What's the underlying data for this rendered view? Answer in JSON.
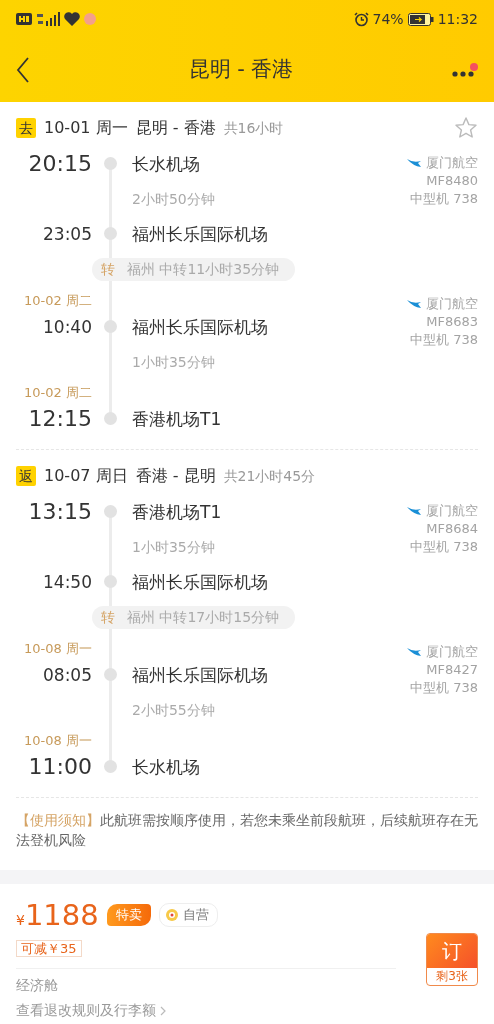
{
  "status_bar": {
    "battery": "74%",
    "time": "11:32"
  },
  "header": {
    "title": "昆明 - 香港",
    "has_notification": true
  },
  "trips": [
    {
      "tag": "去",
      "date": "10-01 周一",
      "route": "昆明 - 香港",
      "total": "共16小时",
      "starred": false,
      "timeline": [
        {
          "kind": "stop",
          "endpoint": true,
          "time": "20:15",
          "airport": "长水机场",
          "airline": {
            "name": "厦门航空",
            "flight": "MF8480",
            "aircraft": "中型机 738"
          }
        },
        {
          "kind": "duration",
          "text": "2小时50分钟"
        },
        {
          "kind": "stop",
          "endpoint": false,
          "time": "23:05",
          "airport": "福州长乐国际机场"
        },
        {
          "kind": "transfer",
          "tag": "转",
          "text": "福州 中转11小时35分钟"
        },
        {
          "kind": "stop",
          "endpoint": false,
          "date": "10-02 周二",
          "time": "10:40",
          "airport": "福州长乐国际机场",
          "airline": {
            "name": "厦门航空",
            "flight": "MF8683",
            "aircraft": "中型机 738"
          }
        },
        {
          "kind": "duration",
          "text": "1小时35分钟"
        },
        {
          "kind": "stop",
          "endpoint": true,
          "date": "10-02 周二",
          "time": "12:15",
          "airport": "香港机场T1"
        }
      ]
    },
    {
      "tag": "返",
      "date": "10-07 周日",
      "route": "香港 - 昆明",
      "total": "共21小时45分",
      "timeline": [
        {
          "kind": "stop",
          "endpoint": true,
          "time": "13:15",
          "airport": "香港机场T1",
          "airline": {
            "name": "厦门航空",
            "flight": "MF8684",
            "aircraft": "中型机 738"
          }
        },
        {
          "kind": "duration",
          "text": "1小时35分钟"
        },
        {
          "kind": "stop",
          "endpoint": false,
          "time": "14:50",
          "airport": "福州长乐国际机场"
        },
        {
          "kind": "transfer",
          "tag": "转",
          "text": "福州 中转17小时15分钟"
        },
        {
          "kind": "stop",
          "endpoint": false,
          "date": "10-08 周一",
          "time": "08:05",
          "airport": "福州长乐国际机场",
          "airline": {
            "name": "厦门航空",
            "flight": "MF8427",
            "aircraft": "中型机 738"
          }
        },
        {
          "kind": "duration",
          "text": "2小时55分钟"
        },
        {
          "kind": "stop",
          "endpoint": true,
          "date": "10-08 周一",
          "time": "11:00",
          "airport": "长水机场"
        }
      ]
    }
  ],
  "notice": {
    "label": "【使用须知】",
    "text": "此航班需按顺序使用，若您未乘坐前段航班，后续航班存在无法登机风险"
  },
  "fare": {
    "currency": "¥",
    "price": "1188",
    "promo_tag": "特卖",
    "self_operated": "自营",
    "discount": "可减￥35",
    "cabin": "经济舱",
    "rules_link": "查看退改规则及行李额",
    "book_button": "订",
    "remaining": "剩3张"
  }
}
